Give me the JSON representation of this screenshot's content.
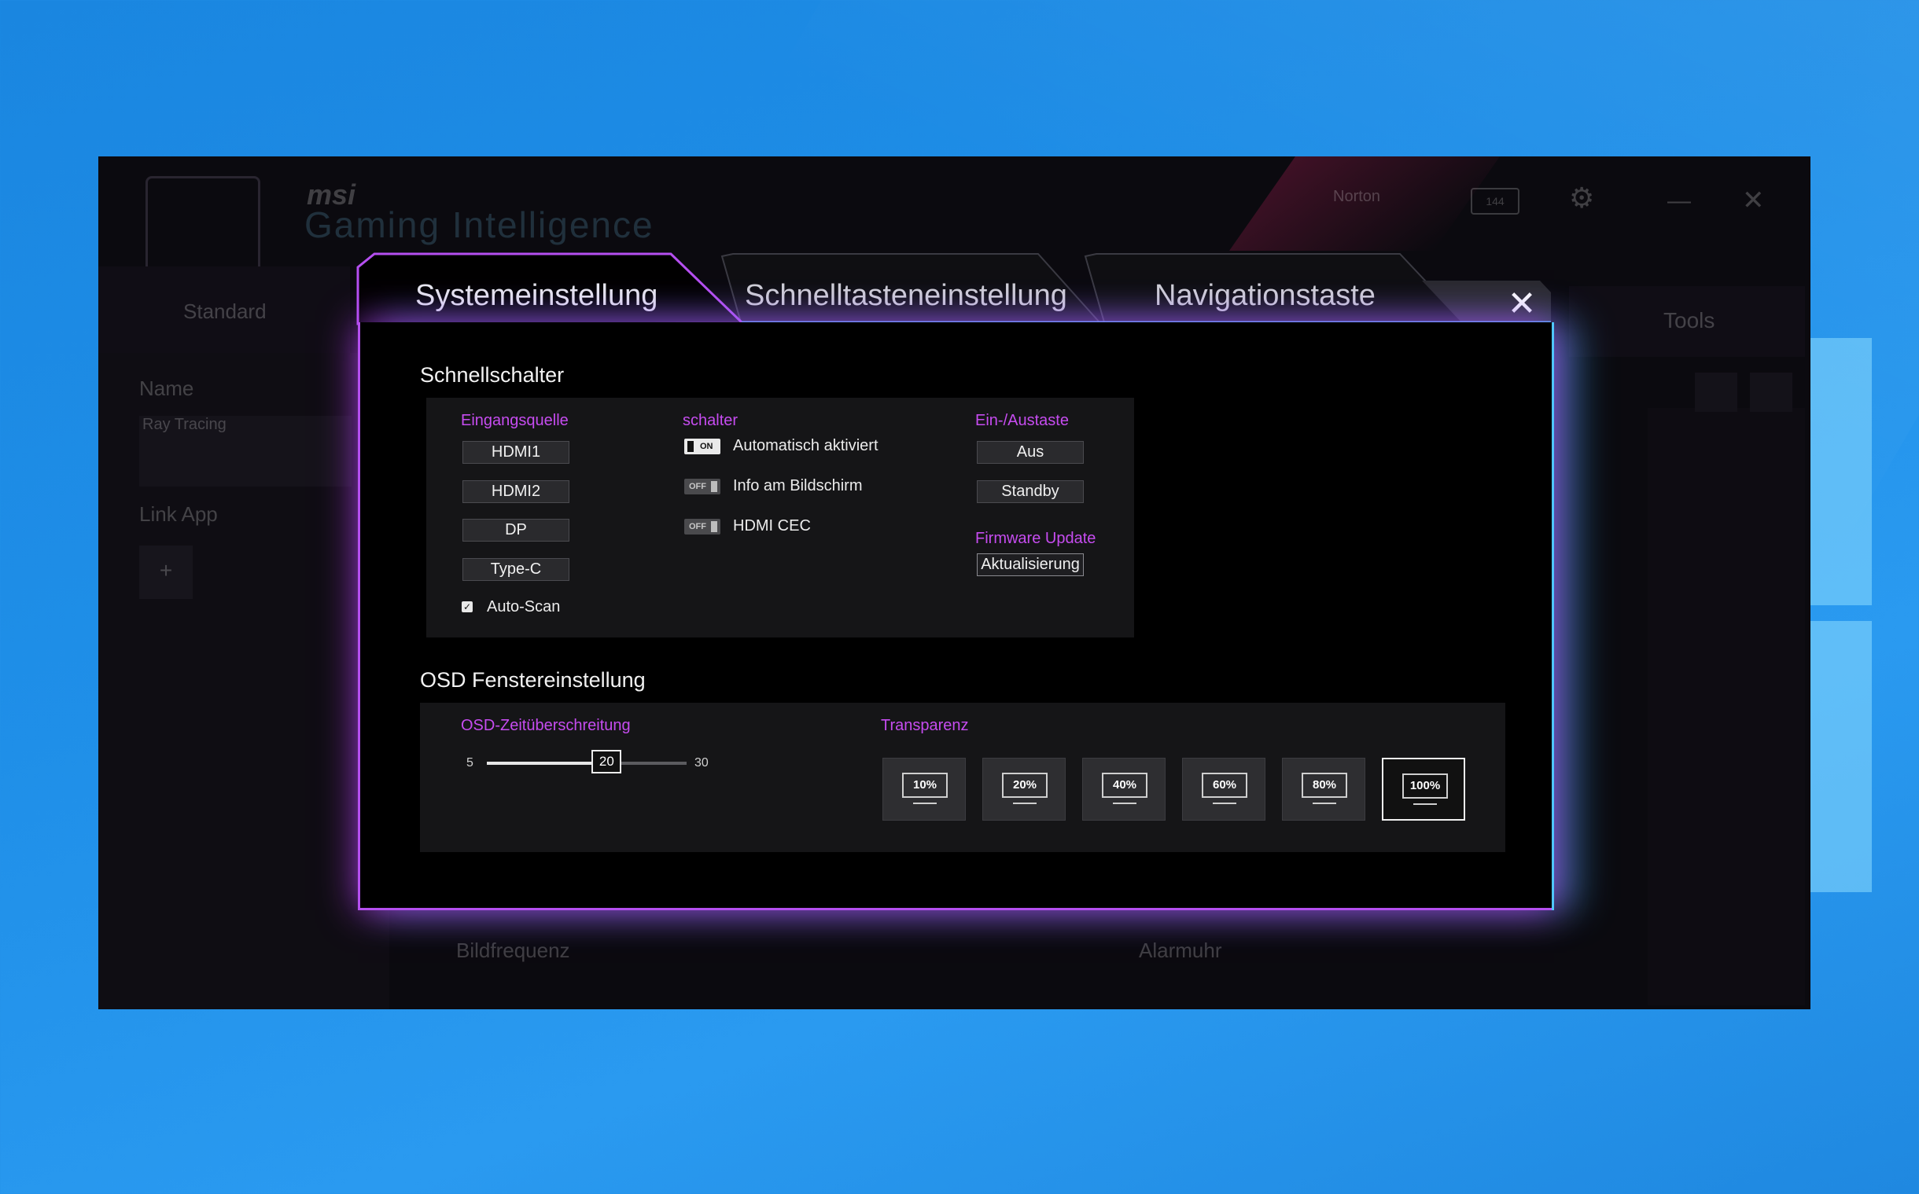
{
  "background_app": {
    "brand": "msi",
    "product": "Gaming Intelligence",
    "norton_label": "Norton",
    "refresh_badge": "144",
    "tab_standard": "Standard",
    "tab_tools": "Tools",
    "name_label": "Name",
    "name_value": "Ray Tracing",
    "link_app_label": "Link App",
    "add_symbol": "+",
    "bildfrequenz_label": "Bildfrequenz",
    "alarmuhr_label": "Alarmuhr",
    "minimize_symbol": "—",
    "close_symbol": "✕"
  },
  "modal": {
    "tabs": {
      "system": "Systemeinstellung",
      "hotkey": "Schnelltasteneinstellung",
      "navigation": "Navigationstaste"
    },
    "close_symbol": "✕",
    "quick_switch": {
      "title": "Schnellschalter",
      "input_source": {
        "label": "Eingangsquelle",
        "options": [
          "HDMI1",
          "HDMI2",
          "DP",
          "Type-C"
        ],
        "auto_scan_label": "Auto-Scan",
        "auto_scan_checked": true
      },
      "switch": {
        "label": "schalter",
        "items": [
          {
            "state": "ON",
            "text": "Automatisch aktiviert"
          },
          {
            "state": "OFF",
            "text": "Info am Bildschirm"
          },
          {
            "state": "OFF",
            "text": "HDMI CEC"
          }
        ]
      },
      "power_key": {
        "label": "Ein-/Austaste",
        "options": [
          "Aus",
          "Standby"
        ]
      },
      "firmware": {
        "label": "Firmware Update",
        "button": "Aktualisierung"
      }
    },
    "osd": {
      "title": "OSD Fenstereinstellung",
      "timeout": {
        "label": "OSD-Zeitüberschreitung",
        "min": 5,
        "max": 30,
        "value": 20
      },
      "transparency": {
        "label": "Transparenz",
        "options": [
          "10%",
          "20%",
          "40%",
          "60%",
          "80%",
          "100%"
        ],
        "selected": "100%"
      }
    }
  },
  "colors": {
    "accent_pink": "#c64cf0",
    "glow_purple": "#b54ff0",
    "glow_cyan": "#4fc6ff"
  }
}
